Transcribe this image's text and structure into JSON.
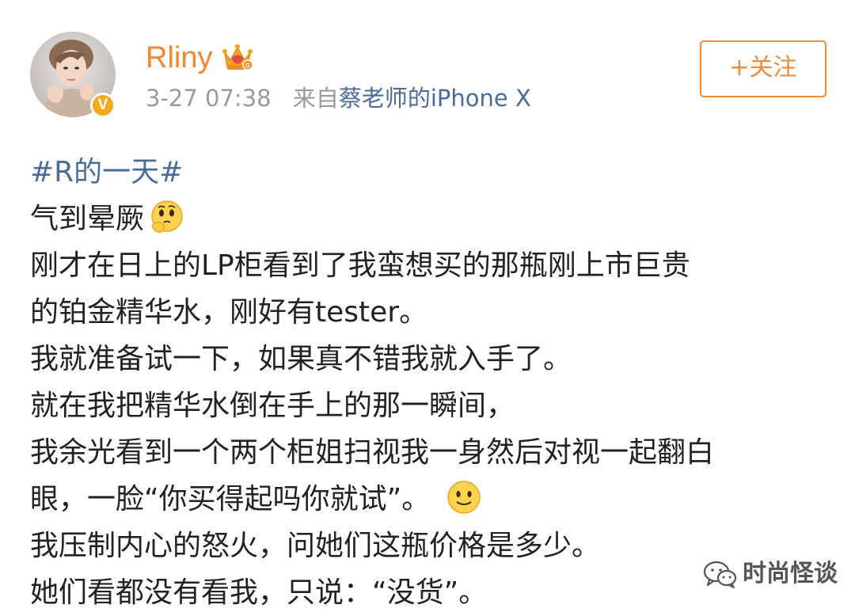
{
  "post": {
    "author": {
      "name": "Rliny",
      "badge_icon": "crown-icon",
      "verified_mark": "V",
      "avatar_icon": "avatar-photo"
    },
    "timestamp": "3-27 07:38",
    "source_prefix": "来自",
    "source_device": "蔡老师的iPhone X",
    "follow_label": "+关注",
    "hashtag": "#R的一天#",
    "lines": [
      "气到晕厥",
      "刚才在日上的LP柜看到了我蛮想买的那瓶刚上市巨贵",
      "的铂金精华水，刚好有tester。",
      "我就准备试一下，如果真不错我就入手了。",
      "就在我把精华水倒在手上的那一瞬间，",
      "我余光看到一个两个柜姐扫视我一身然后对视一起翻白",
      "眼，一脸“你买得起吗你就试”。",
      "我压制内心的怒火，问她们这瓶价格是多少。",
      "她们看都没有看我，只说：“没货”。"
    ],
    "emojis": {
      "line1": "thinking-face-emoji",
      "line7": "smiling-face-emoji"
    }
  },
  "watermark": {
    "icon": "wechat-icon",
    "text": "时尚怪谈"
  },
  "colors": {
    "username": "#f4872f",
    "link": "#4c6b99",
    "follow_border": "#f08a3c",
    "meta_gray": "#9a9a9a",
    "verified": "#f3a91f"
  }
}
